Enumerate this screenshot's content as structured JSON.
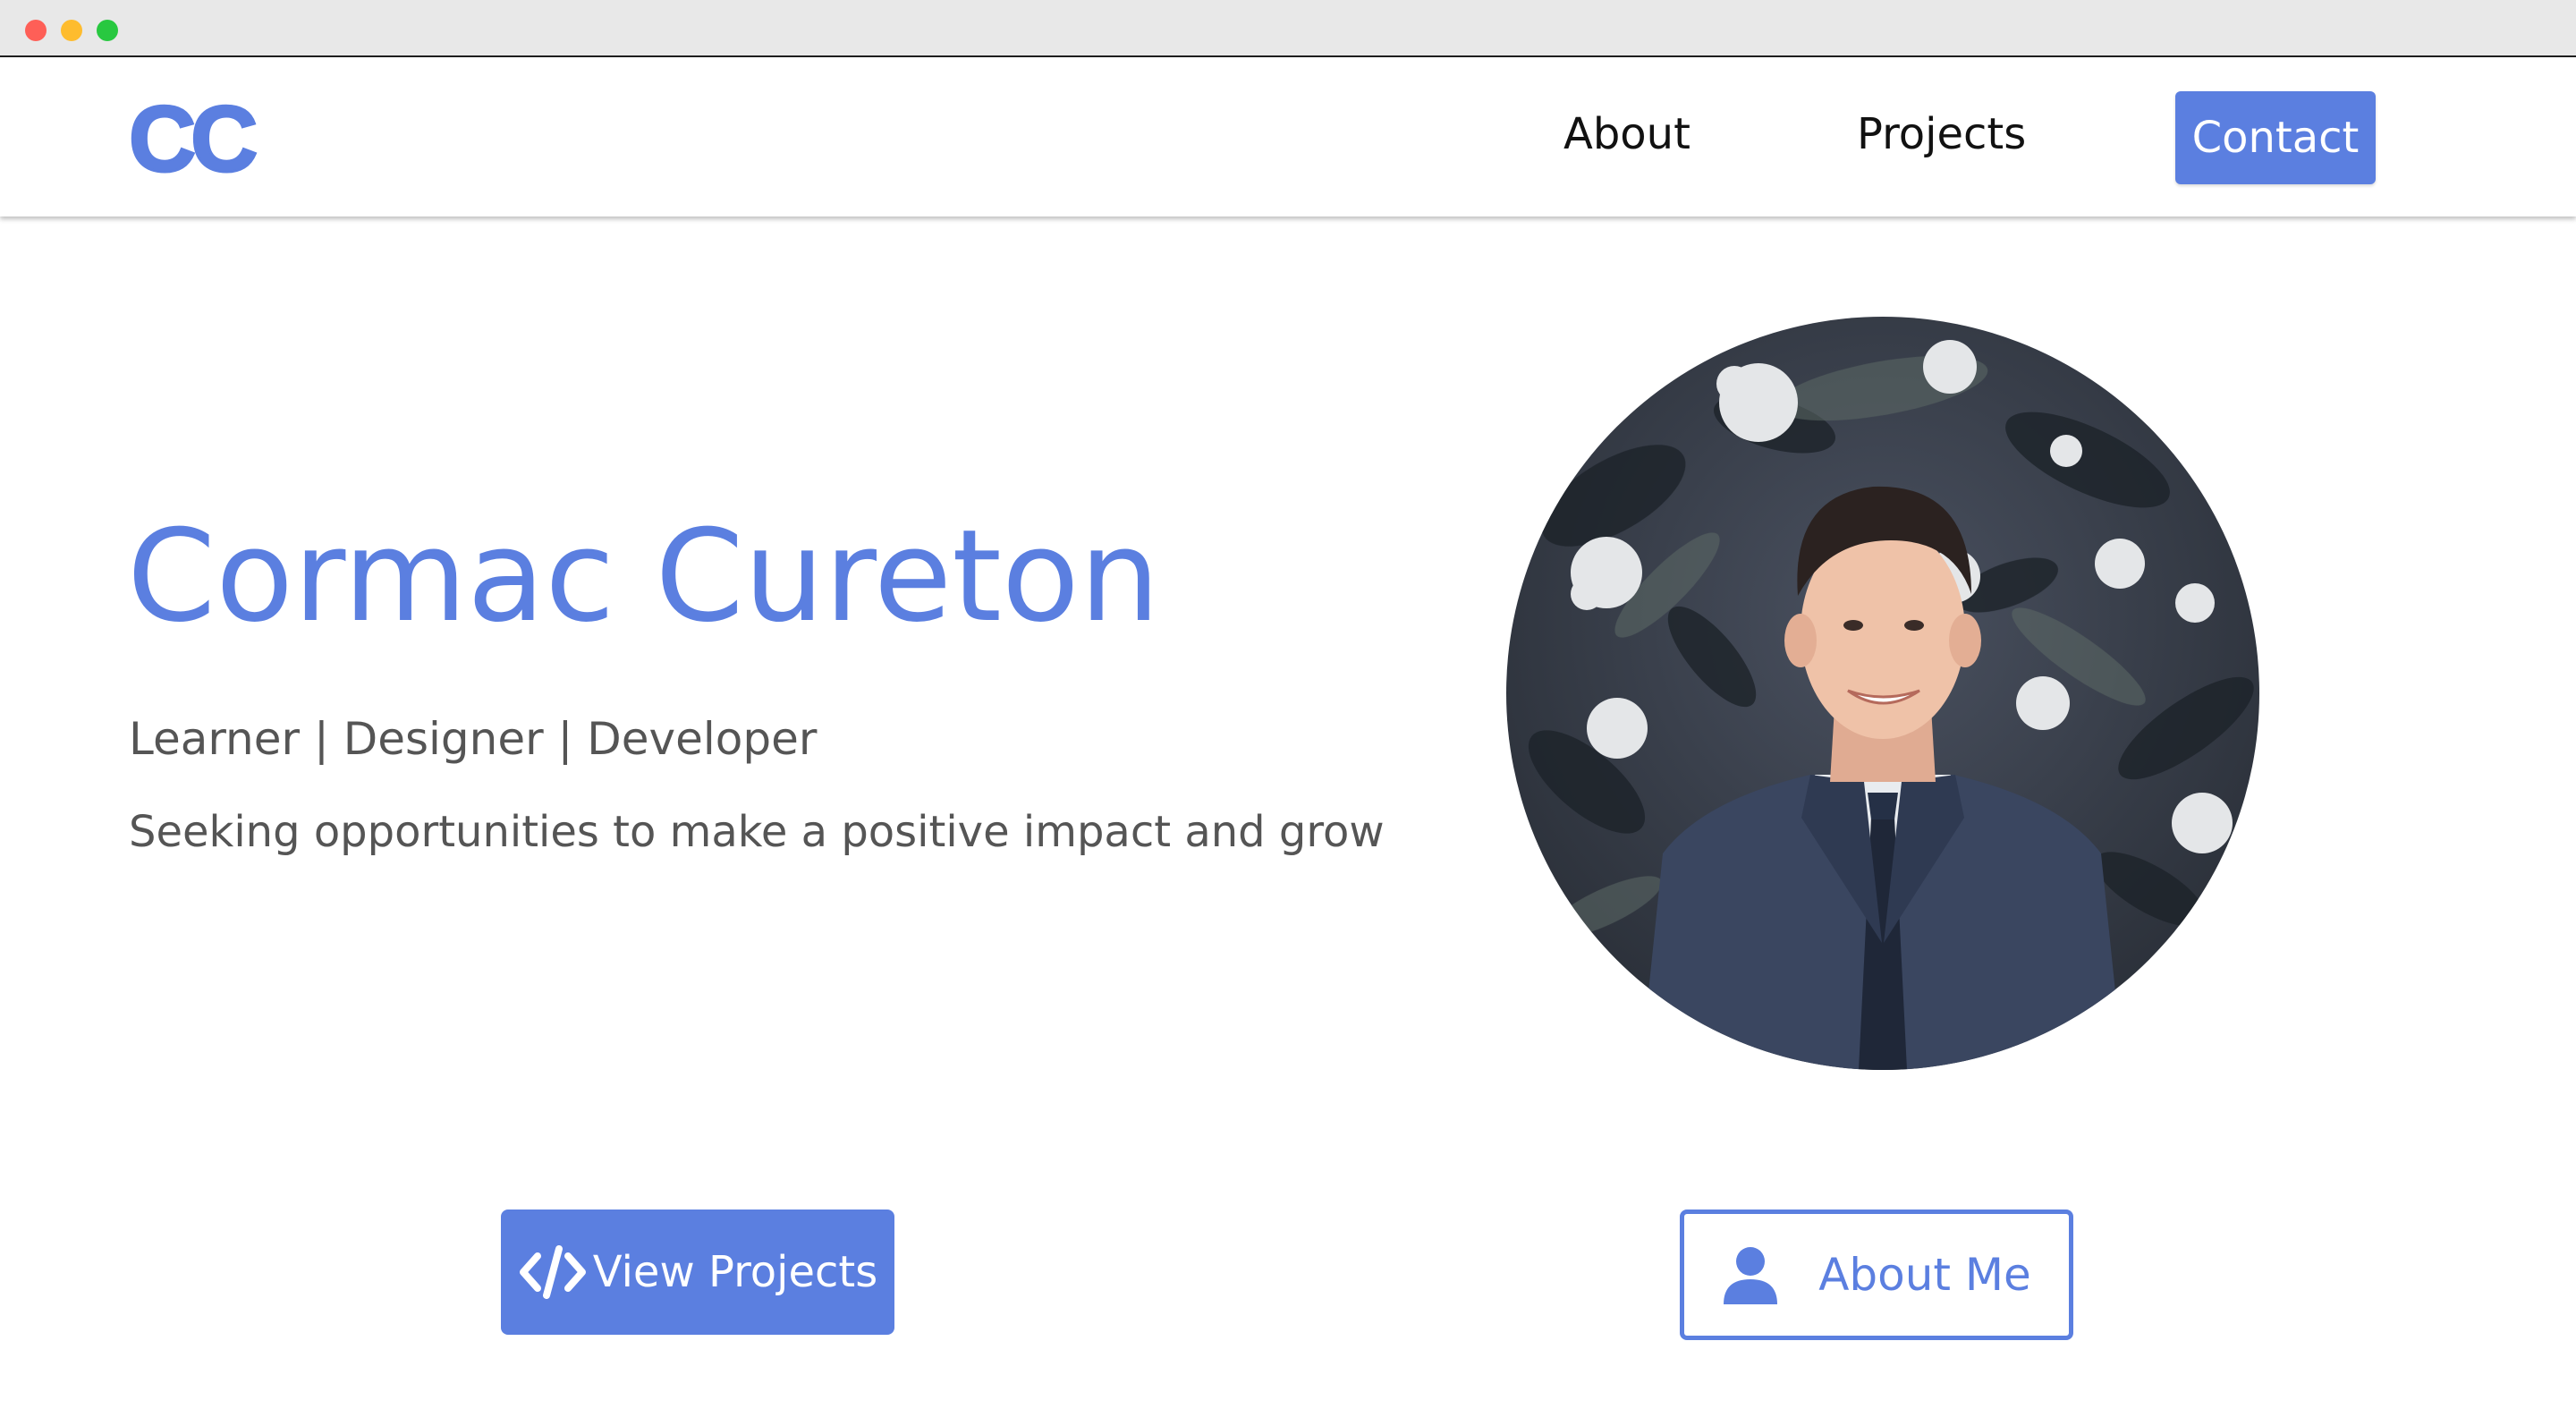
{
  "window": {
    "controls": [
      "close",
      "minimize",
      "maximize"
    ]
  },
  "nav": {
    "logo": "CC",
    "links": [
      {
        "label": "About"
      },
      {
        "label": "Projects"
      }
    ],
    "contact_label": "Contact"
  },
  "hero": {
    "name": "Cormac Cureton",
    "roles": "Learner | Designer | Developer",
    "tagline": "Seeking opportunities to make a positive impact and grow",
    "portrait_icon": "portrait-photo"
  },
  "actions": {
    "view_projects": {
      "label": "View Projects",
      "icon": "code-icon"
    },
    "about_me": {
      "label": "About Me",
      "icon": "person-icon"
    }
  },
  "colors": {
    "accent": "#5b7fe0",
    "body_text": "#555555",
    "nav_text": "#111111"
  }
}
